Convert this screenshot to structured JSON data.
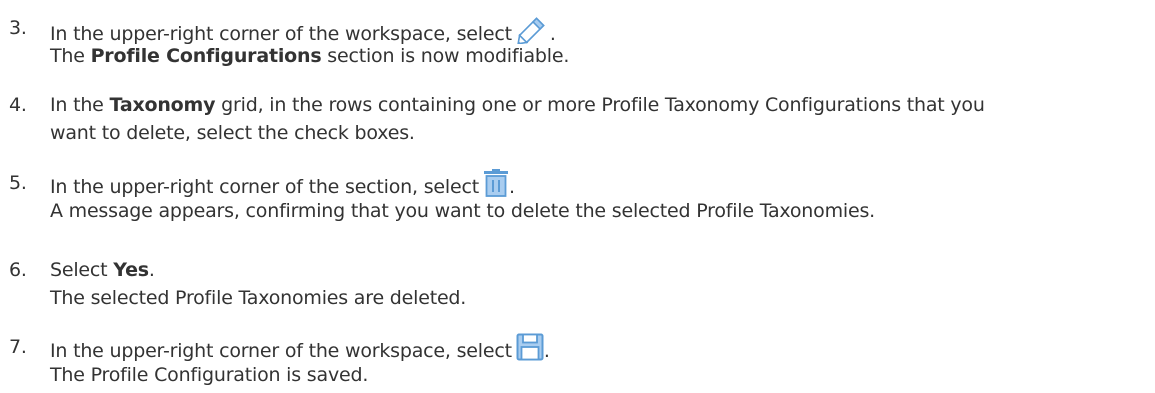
{
  "steps": [
    {
      "number": "3.",
      "text_before_icon": "In the upper-right corner of the workspace, select",
      "icon": "pencil-edit-icon",
      "text_after_icon": ".",
      "result_bold": "Profile Configurations",
      "result_rest": " section is now modifiable.",
      "result_prefix": "The "
    },
    {
      "number": "4.",
      "line1_prefix": "In the ",
      "line1_bold": "Taxonomy",
      "line1_rest": " grid, in the rows containing one or more Profile Taxonomy Configurations that you",
      "line2": "want to delete, select the check boxes."
    },
    {
      "number": "5.",
      "text_before_icon": "In the upper-right corner of the section, select",
      "icon": "trash-delete-icon",
      "text_after_icon": ".",
      "result": "A message appears, confirming that you want to delete the selected Profile Taxonomies."
    },
    {
      "number": "6.",
      "prefix": "Select ",
      "bold": "Yes",
      "suffix": ".",
      "result": "The selected Profile Taxonomies are deleted."
    },
    {
      "number": "7.",
      "text_before_icon": "In the upper-right corner of the workspace, select",
      "icon": "save-disk-icon",
      "text_after_icon": ".",
      "result": "The Profile Configuration is saved."
    }
  ],
  "colors": {
    "text": "#333333",
    "icon_blue": "#5b9bd5",
    "icon_light_blue": "#a9cdf0"
  }
}
